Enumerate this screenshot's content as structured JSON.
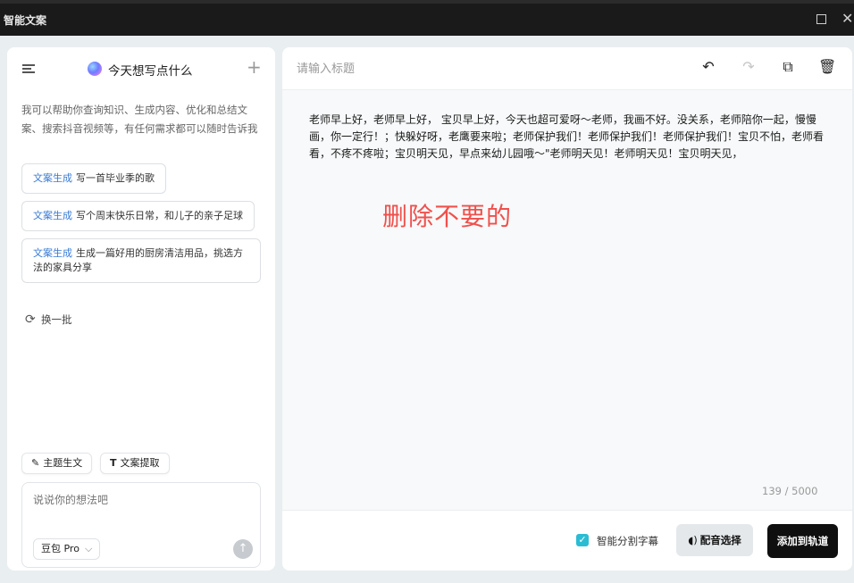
{
  "window": {
    "title": "智能文案"
  },
  "left": {
    "header_title": "今天想写点什么",
    "intro": "我可以帮助你查询知识、生成内容、优化和总结文案、搜索抖音视频等，有任何需求都可以随时告诉我",
    "suggestions": [
      {
        "tag": "文案生成",
        "text": "写一首毕业季的歌"
      },
      {
        "tag": "文案生成",
        "text": "写个周末快乐日常，和儿子的亲子足球"
      },
      {
        "tag": "文案生成",
        "text": "生成一篇好用的厨房清洁用品，挑选方法的家具分享"
      }
    ],
    "refresh_label": "换一批",
    "chips": [
      {
        "icon": "✎",
        "label": "主题生文"
      },
      {
        "icon": "T",
        "label": "文案提取"
      }
    ],
    "input": {
      "placeholder": "说说你的想法吧"
    },
    "model": {
      "label": "豆包 Pro"
    }
  },
  "right": {
    "title_placeholder": "请输入标题",
    "body_text": "老师早上好，老师早上好， 宝贝早上好，今天也超可爱呀～老师，我画不好。没关系，老师陪你一起，慢慢画，你一定行！；快躲好呀，老鹰要来啦；老师保护我们！老师保护我们！老师保护我们！宝贝不怕，老师看看，不疼不疼啦；宝贝明天见，早点来幼儿园哦～\"老师明天见！老师明天见！宝贝明天见，",
    "annotation": "删除不要的",
    "counter": "139 / 5000",
    "smart_subtitle_label": "智能分割字幕",
    "smart_subtitle_checked": true,
    "voice_button_label": "配音选择",
    "add_button_label": "添加到轨道"
  },
  "colors": {
    "accent": "#2bbcd4",
    "tag_blue": "#3a7bd5",
    "annotation_red": "#f0504c",
    "primary_button": "#0f0f10"
  }
}
